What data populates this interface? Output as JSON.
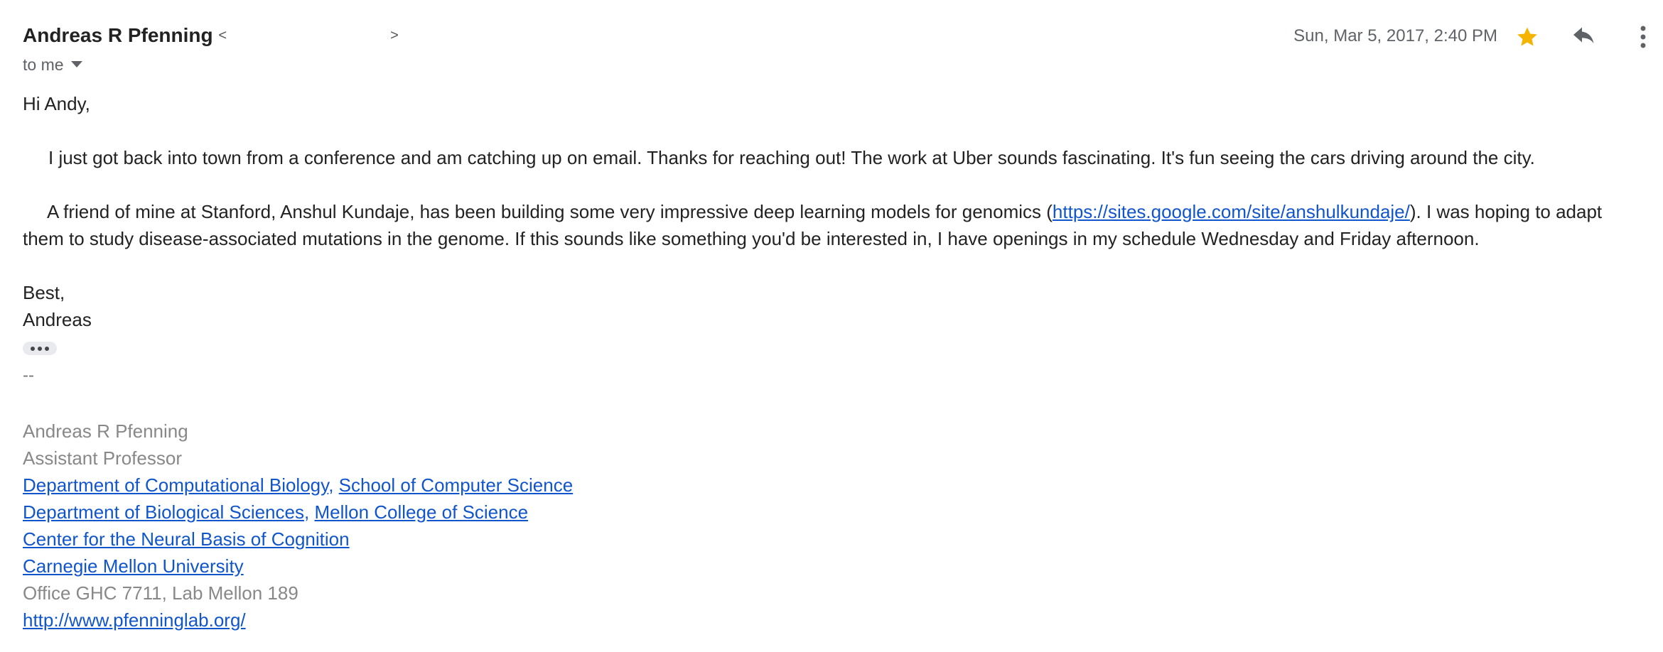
{
  "message": {
    "sender_name": "Andreas R Pfenning",
    "sender_email_open": "<",
    "sender_email_close": ">",
    "to_label": "to me",
    "date": "Sun, Mar 5, 2017, 2:40 PM",
    "icons": {
      "star": "star-icon",
      "reply": "reply-icon",
      "more": "more-vert-icon",
      "expand": "chevron-down-icon"
    },
    "colors": {
      "star": "#f4b400",
      "link": "#1155cc",
      "secondary_text": "#5f6368"
    }
  },
  "body": {
    "greeting": "Hi Andy,",
    "para1": "I just got back into town from a conference and am catching up on email. Thanks for reaching out! The work at Uber sounds fascinating. It's fun seeing the cars driving around the city.",
    "para2_before": "A friend of mine at Stanford, Anshul Kundaje, has been building some very impressive deep learning models for genomics (",
    "para2_link": "https://sites.google.com/site/anshulkundaje/",
    "para2_after": "). I was hoping to adapt them to study disease-associated mutations in the genome. If this sounds like something you'd be interested in, I have openings in my schedule Wednesday and Friday afternoon.",
    "closing": "Best,",
    "signoff": "Andreas"
  },
  "signature": {
    "separator": "--",
    "name": "Andreas R Pfenning",
    "title": "Assistant Professor",
    "dept1": "Department of Computational Biology",
    "comma1": ",",
    "school1": "School of Computer Science",
    "dept2": "Department of Biological Sciences",
    "comma2": ",",
    "school2": "Mellon College of Science",
    "center": "Center for the Neural Basis of Cognition",
    "university": "Carnegie Mellon University",
    "office": "Office GHC 7711, Lab Mellon 189",
    "website": "http://www.pfenninglab.org/"
  }
}
